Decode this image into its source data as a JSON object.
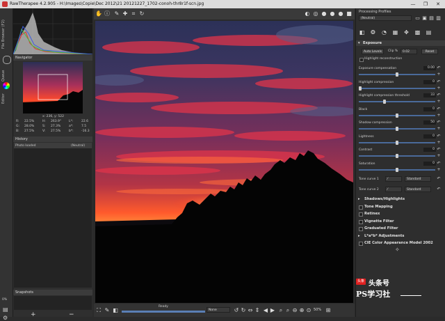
{
  "window": {
    "title": "RawTherapee 4.2.905 - H:\\Images\\Copie\\Dec 2012\\21 20121227_1702-conoh-thr8r1f-scn.jpg",
    "min": "—",
    "max": "❐",
    "close": "✕"
  },
  "vtabs": [
    "File Browser (F2)",
    "Queue",
    "Editor"
  ],
  "left": {
    "navigator_title": "Navigator",
    "coords": "x: 236, y: 522",
    "info": [
      [
        "R:",
        "22.5%",
        "H:",
        "263.9°",
        "L*:",
        "22.6"
      ],
      [
        "G:",
        "28.0%",
        "S:",
        "27.3%",
        "a*:",
        "7.5"
      ],
      [
        "B:",
        "27.5%",
        "V:",
        "27.5%",
        "b*:",
        "-16.3"
      ]
    ],
    "history_title": "History",
    "history_rows": [
      [
        "Photo loaded",
        "(Neutral)"
      ]
    ],
    "snapshots_title": "Snapshots",
    "zero_pct": "0%",
    "add": "+",
    "remove": "−"
  },
  "bottom": {
    "status": "Ready",
    "zoom_text": "None",
    "zoom_pct": "50%"
  },
  "right": {
    "profiles_title": "Processing Profiles",
    "profile_selected": "(Neutral)",
    "exposure_title": "Exposure",
    "auto_levels": "Auto Levels",
    "clip_label": "Clip %",
    "clip_value": "0.02",
    "reset": "Reset",
    "highlight_recon": "Highlight reconstruction",
    "controls": [
      {
        "label": "Exposure compensation",
        "value": "0.00",
        "pos": 0.5
      },
      {
        "label": "Highlight compression",
        "value": "0",
        "pos": 0.0
      },
      {
        "label": "Highlight compression threshold",
        "value": "33",
        "pos": 0.33
      },
      {
        "label": "Black",
        "value": "0",
        "pos": 0.5
      },
      {
        "label": "Shadow compression",
        "value": "50",
        "pos": 0.5
      },
      {
        "label": "Lightness",
        "value": "0",
        "pos": 0.5
      },
      {
        "label": "Contrast",
        "value": "0",
        "pos": 0.5
      },
      {
        "label": "Saturation",
        "value": "0",
        "pos": 0.5
      }
    ],
    "tone_curve_1": "Tone curve 1",
    "tone_curve_2": "Tone curve 2",
    "standard": "Standard",
    "sections": [
      "Shadows/Highlights",
      "Tone Mapping",
      "Retinex",
      "Vignette Filter",
      "Graduated Filter",
      "L*a*b* Adjustments",
      "CIE Color Appearance Model 2002"
    ]
  },
  "watermark": {
    "line1": "头条号",
    "line2": "PS学习社",
    "badge": "头条"
  },
  "colors": {
    "accent": "#5a7fb5",
    "bg": "#2b2b2b"
  }
}
